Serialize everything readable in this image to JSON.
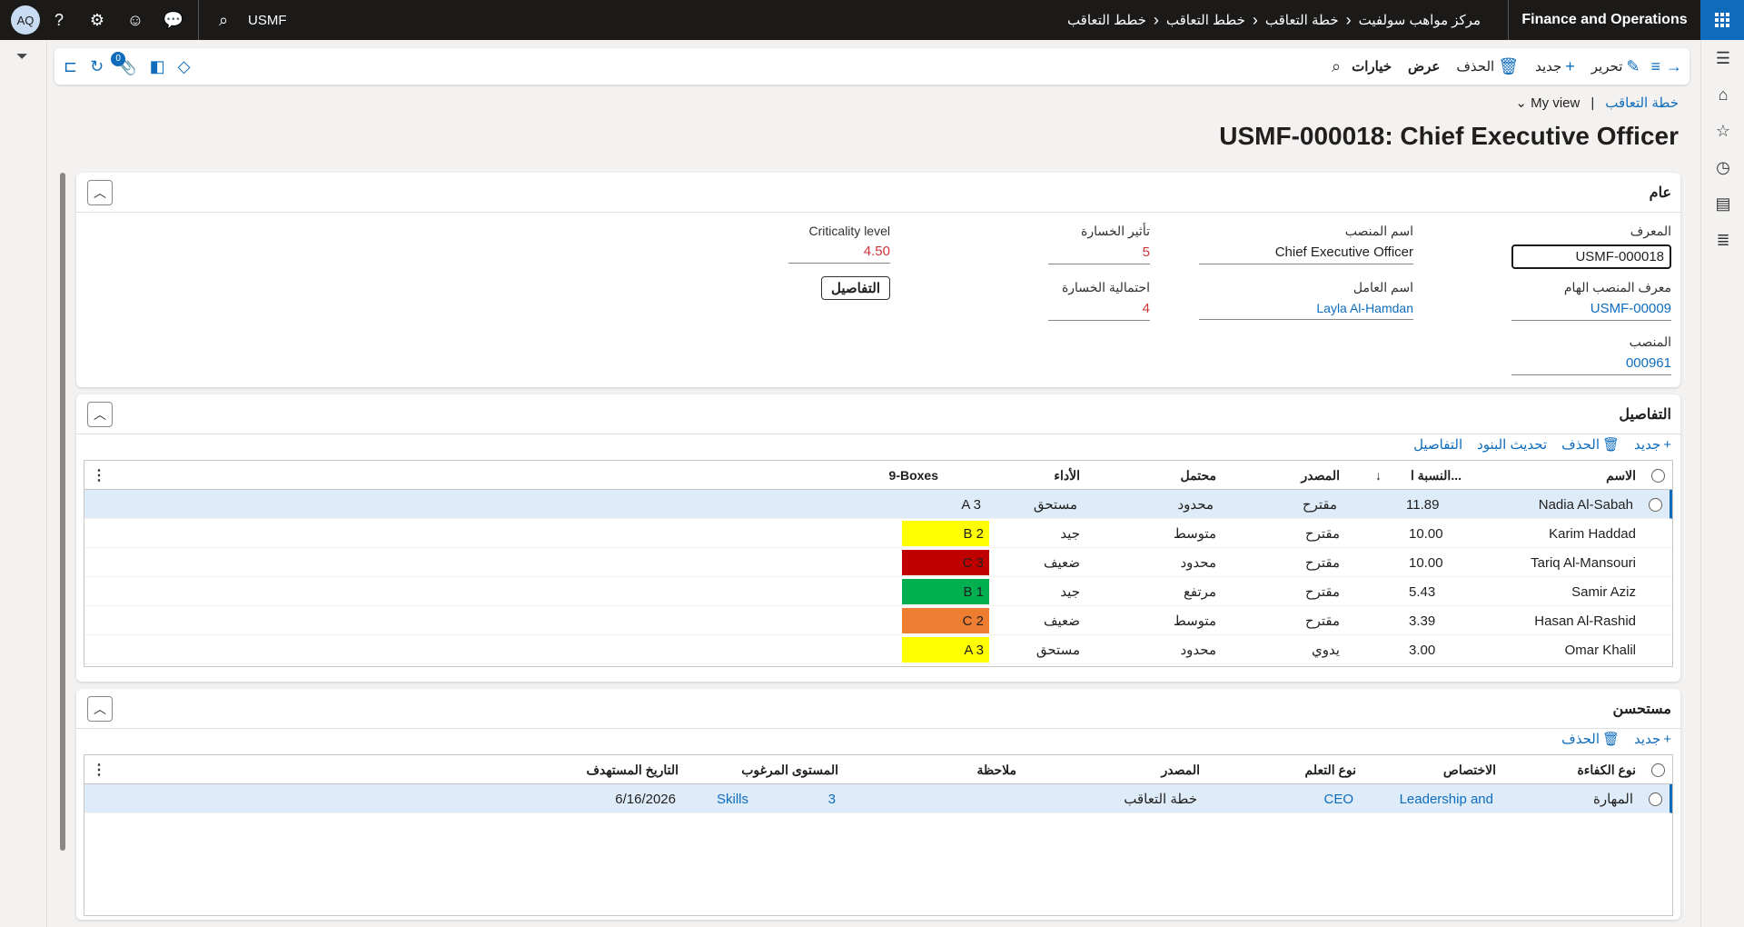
{
  "topbar": {
    "app_title": "Finance and Operations",
    "company": "USMF",
    "avatar": "AQ",
    "breadcrumbs": [
      "مركز مواهب سولفيت",
      "خطة التعاقب",
      "خطط التعاقب",
      "خطط التعاقب"
    ],
    "icons": [
      "app-launcher-icon",
      "search-icon",
      "chat-icon",
      "smiley-icon",
      "gear-icon",
      "help-icon"
    ]
  },
  "actionbar": {
    "back": "→",
    "edit": "تحرير",
    "new": "جديد",
    "delete": "الحذف",
    "view": "عرض",
    "options": "خيارات",
    "attachments_count": "0"
  },
  "header": {
    "breadcrumb_link": "خطة التعاقب",
    "view_name": "My view",
    "title": "USMF-000018: Chief Executive Officer"
  },
  "general": {
    "section_title": "عام",
    "id_label": "المعرف",
    "id_value": "USMF-000018",
    "critical_position_label": "معرف المنصب الهام",
    "critical_position_value": "USMF-00009",
    "position_label": "المنصب",
    "position_value": "000961",
    "job_name_label": "اسم المنصب",
    "job_name_value": "Chief Executive Officer",
    "worker_name_label": "اسم العامل",
    "worker_name_value": "Layla Al-Hamdan",
    "loss_impact_label": "تأثير الخسارة",
    "loss_impact_value": "5",
    "loss_probability_label": "احتمالية الخسارة",
    "loss_probability_value": "4",
    "criticality_label": "Criticality level",
    "criticality_value": "4.50",
    "details_button": "التفاصيل"
  },
  "details": {
    "section_title": "التفاصيل",
    "toolbar": {
      "new": "جديد",
      "delete": "الحذف",
      "refresh": "تحديث البنود",
      "details": "التفاصيل"
    },
    "columns": {
      "name": "الاسم",
      "percent": "النسبة ا...",
      "source": "المصدر",
      "potential": "محتمل",
      "performance": "الأداء",
      "boxes": "9-Boxes"
    },
    "rows": [
      {
        "name": "Nadia Al-Sabah",
        "percent": "11.89",
        "source": "مقترح",
        "potential": "محدود",
        "performance": "مستحق",
        "box": "A 3",
        "color": ""
      },
      {
        "name": "Karim Haddad",
        "percent": "10.00",
        "source": "مقترح",
        "potential": "متوسط",
        "performance": "جيد",
        "box": "B 2",
        "color": "#ffff00"
      },
      {
        "name": "Tariq Al-Mansouri",
        "percent": "10.00",
        "source": "مقترح",
        "potential": "محدود",
        "performance": "ضعيف",
        "box": "C 3",
        "color": "#c00000"
      },
      {
        "name": "Samir Aziz",
        "percent": "5.43",
        "source": "مقترح",
        "potential": "مرتفع",
        "performance": "جيد",
        "box": "B 1",
        "color": "#00b050"
      },
      {
        "name": "Hasan Al-Rashid",
        "percent": "3.39",
        "source": "مقترح",
        "potential": "متوسط",
        "performance": "ضعيف",
        "box": "C 2",
        "color": "#ed7d31"
      },
      {
        "name": "Omar Khalil",
        "percent": "3.00",
        "source": "يدوي",
        "potential": "محدود",
        "performance": "مستحق",
        "box": "A 3",
        "color": "#ffff00"
      }
    ]
  },
  "desired": {
    "section_title": "مستحسن",
    "toolbar": {
      "new": "جديد",
      "delete": "الحذف"
    },
    "columns": {
      "type": "نوع الكفاءة",
      "specialty": "الاختصاص",
      "learning": "نوع التعلم",
      "source": "المصدر",
      "note": "ملاحظة",
      "level": "المستوى المرغوب",
      "date": "التاريخ المستهدف"
    },
    "rows": [
      {
        "type": "المهارة",
        "specialty": "Leadership and",
        "learning": "CEO",
        "source": "خطة التعاقب",
        "note": "",
        "level": "3",
        "level_type": "Skills",
        "date": "6/16/2026"
      }
    ]
  }
}
